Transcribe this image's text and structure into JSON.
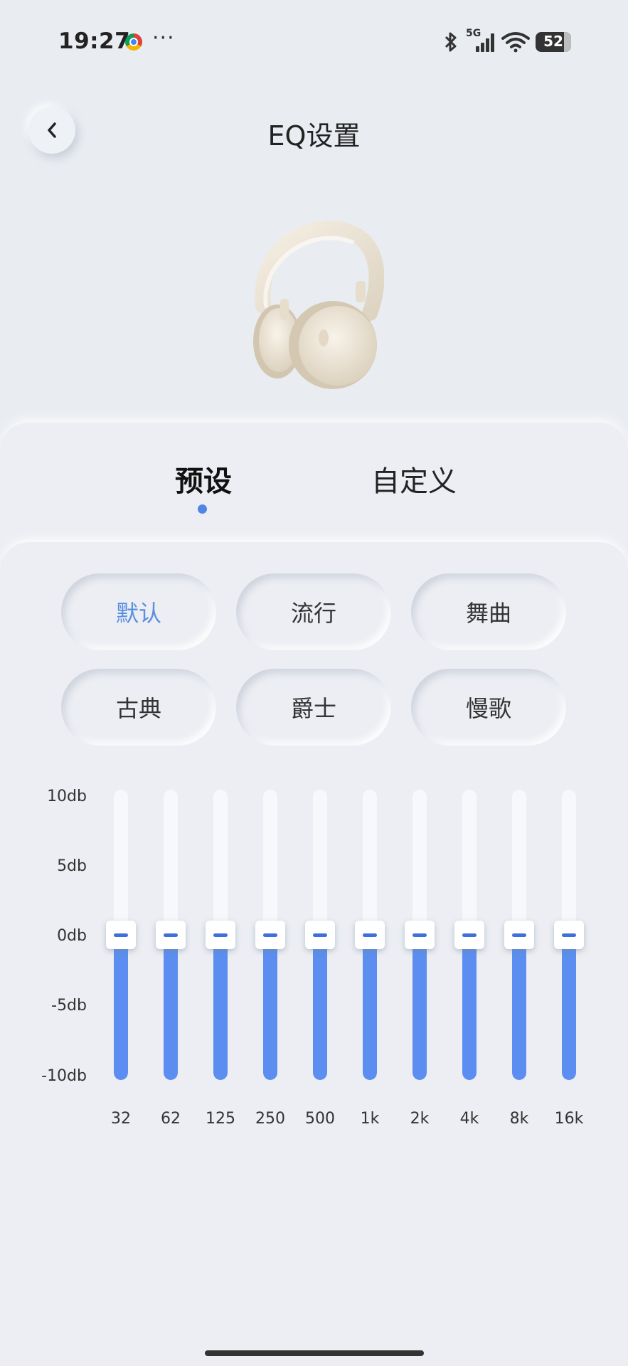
{
  "status_bar": {
    "time": "19:27",
    "more": "···",
    "network": "5G",
    "battery": "52",
    "battery_level": 0.52,
    "icons": [
      "chrome-icon",
      "bluetooth-icon",
      "signal-icon",
      "wifi-icon",
      "battery-icon"
    ]
  },
  "header": {
    "title": "EQ设置",
    "back_icon": "chevron-left-icon"
  },
  "tabs": [
    {
      "label": "预设",
      "active": true
    },
    {
      "label": "自定义",
      "active": false
    }
  ],
  "presets": [
    {
      "label": "默认",
      "active": true
    },
    {
      "label": "流行",
      "active": false
    },
    {
      "label": "舞曲",
      "active": false
    },
    {
      "label": "古典",
      "active": false
    },
    {
      "label": "爵士",
      "active": false
    },
    {
      "label": "慢歌",
      "active": false
    }
  ],
  "colors": {
    "accent": "#5b8ef0",
    "active_text": "#5a8ee0",
    "background": "#e9ecf1"
  },
  "eq": {
    "db_labels": [
      "10db",
      "5db",
      "0db",
      "-5db",
      "-10db"
    ],
    "range_db": [
      -10,
      10
    ],
    "bands": [
      {
        "freq": "32",
        "gain_db": 0
      },
      {
        "freq": "62",
        "gain_db": 0
      },
      {
        "freq": "125",
        "gain_db": 0
      },
      {
        "freq": "250",
        "gain_db": 0
      },
      {
        "freq": "500",
        "gain_db": 0
      },
      {
        "freq": "1k",
        "gain_db": 0
      },
      {
        "freq": "2k",
        "gain_db": 0
      },
      {
        "freq": "4k",
        "gain_db": 0
      },
      {
        "freq": "8k",
        "gain_db": 0
      },
      {
        "freq": "16k",
        "gain_db": 0
      }
    ]
  }
}
